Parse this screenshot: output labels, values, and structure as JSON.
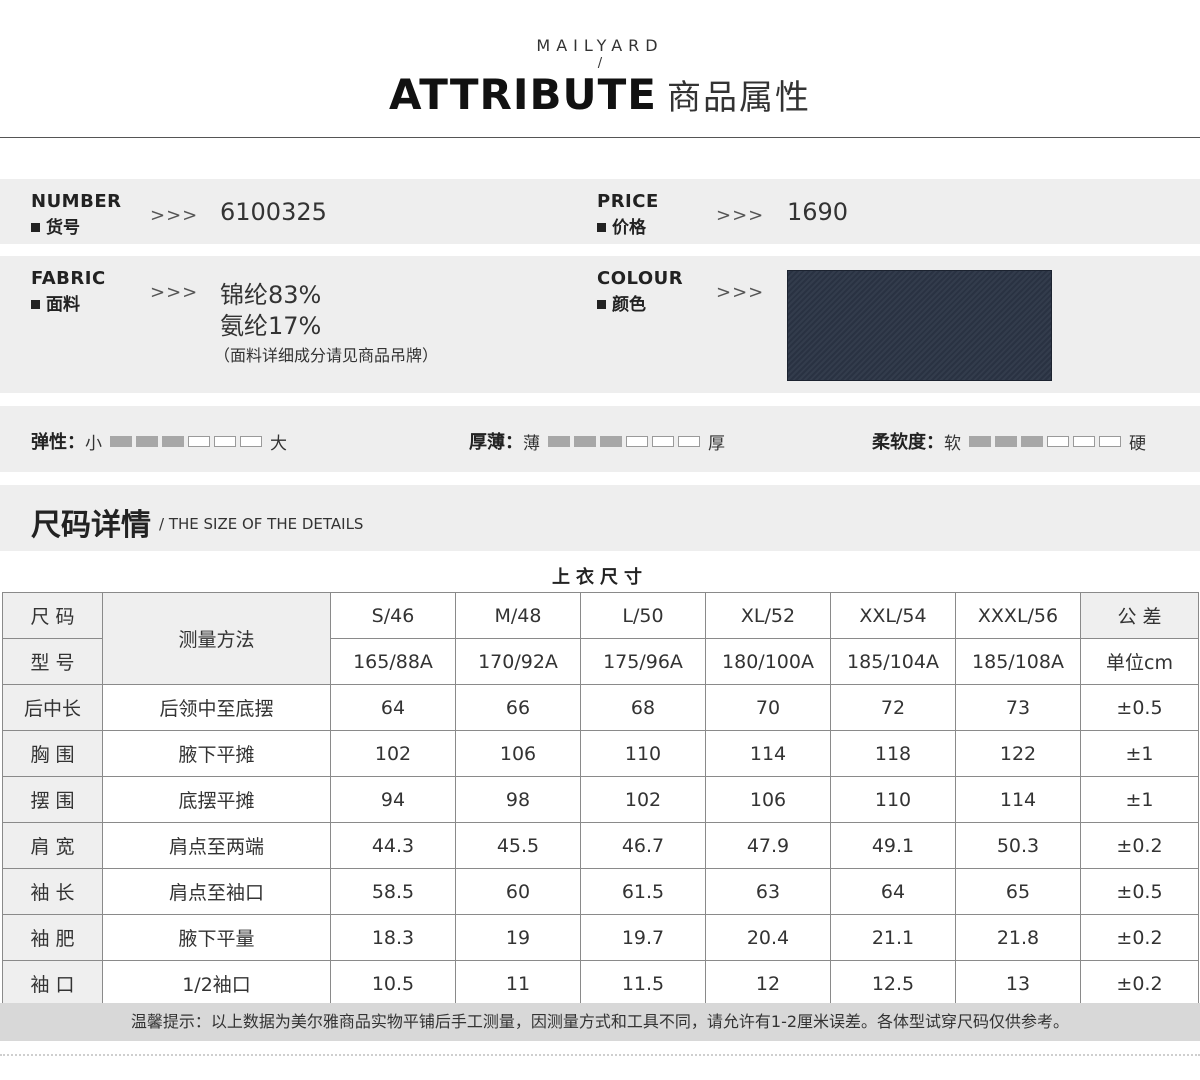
{
  "header": {
    "brand": "MAILYARD",
    "slash": "/",
    "title_en": "ATTRIBUTE",
    "title_cn": "商品属性"
  },
  "info": {
    "arrows": ">>>",
    "number": {
      "label_en": "NUMBER",
      "label_cn": "货号",
      "value": "6100325"
    },
    "price": {
      "label_en": "PRICE",
      "label_cn": "价格",
      "value": "1690"
    },
    "fabric": {
      "label_en": "FABRIC",
      "label_cn": "面料",
      "line1": "锦纶83%",
      "line2": "氨纶17%",
      "note": "（面料详细成分请见商品吊牌）"
    },
    "colour": {
      "label_en": "COLOUR",
      "label_cn": "颜色",
      "swatch_color": "#2b3445"
    }
  },
  "ratings": [
    {
      "label": "弹性：",
      "low": "小",
      "high": "大",
      "level": 3,
      "max": 6
    },
    {
      "label": "厚薄：",
      "low": "薄",
      "high": "厚",
      "level": 3,
      "max": 6
    },
    {
      "label": "柔软度：",
      "low": "软",
      "high": "硬",
      "level": 3,
      "max": 6
    }
  ],
  "size_section": {
    "title": "尺码详情",
    "subtitle": "/ THE SIZE OF THE DETAILS",
    "caption": "上衣尺寸"
  },
  "table": {
    "h_size": "尺 码",
    "h_model": "型 号",
    "h_method": "测量方法",
    "h_tol": "公 差",
    "h_unit": "单位cm",
    "sizes": [
      "S/46",
      "M/48",
      "L/50",
      "XL/52",
      "XXL/54",
      "XXXL/56"
    ],
    "models": [
      "165/88A",
      "170/92A",
      "175/96A",
      "180/100A",
      "185/104A",
      "185/108A"
    ],
    "rows": [
      {
        "name": "后中长",
        "method": "后领中至底摆",
        "values": [
          "64",
          "66",
          "68",
          "70",
          "72",
          "73"
        ],
        "tol": "±0.5"
      },
      {
        "name": "胸 围",
        "method": "腋下平摊",
        "values": [
          "102",
          "106",
          "110",
          "114",
          "118",
          "122"
        ],
        "tol": "±1"
      },
      {
        "name": "摆 围",
        "method": "底摆平摊",
        "values": [
          "94",
          "98",
          "102",
          "106",
          "110",
          "114"
        ],
        "tol": "±1"
      },
      {
        "name": "肩 宽",
        "method": "肩点至两端",
        "values": [
          "44.3",
          "45.5",
          "46.7",
          "47.9",
          "49.1",
          "50.3"
        ],
        "tol": "±0.2"
      },
      {
        "name": "袖 长",
        "method": "肩点至袖口",
        "values": [
          "58.5",
          "60",
          "61.5",
          "63",
          "64",
          "65"
        ],
        "tol": "±0.5"
      },
      {
        "name": "袖 肥",
        "method": "腋下平量",
        "values": [
          "18.3",
          "19",
          "19.7",
          "20.4",
          "21.1",
          "21.8"
        ],
        "tol": "±0.2"
      },
      {
        "name": "袖 口",
        "method": "1/2袖口",
        "values": [
          "10.5",
          "11",
          "11.5",
          "12",
          "12.5",
          "13"
        ],
        "tol": "±0.2"
      }
    ]
  },
  "tip": "温馨提示：以上数据为美尔雅商品实物平铺后手工测量，因测量方式和工具不同，请允许有1-2厘米误差。各体型试穿尺码仅供参考。"
}
